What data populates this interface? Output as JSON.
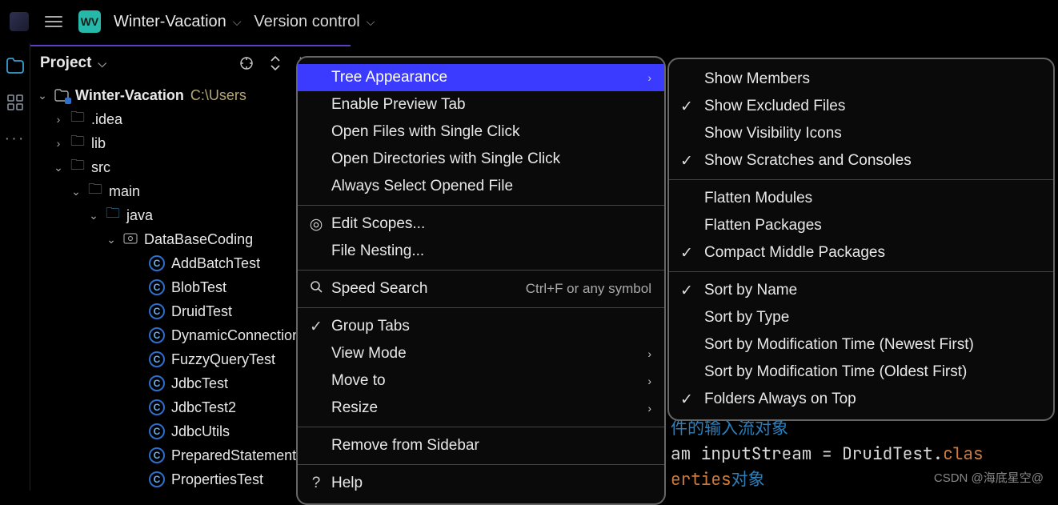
{
  "titlebar": {
    "wv_badge": "WV",
    "project_name": "Winter-Vacation",
    "version_control": "Version control"
  },
  "panel": {
    "title": "Project"
  },
  "tree": {
    "root_name": "Winter-Vacation",
    "root_path": "C:\\Users",
    "idea": ".idea",
    "lib": "lib",
    "src": "src",
    "main": "main",
    "java": "java",
    "pkg": "DataBaseCoding",
    "c0": "AddBatchTest",
    "c1": "BlobTest",
    "c2": "DruidTest",
    "c3": "DynamicConnection",
    "c4": "FuzzyQueryTest",
    "c5": "JdbcTest",
    "c6": "JdbcTest2",
    "c7": "JdbcUtils",
    "c8": "PreparedStatement",
    "c9": "PropertiesTest"
  },
  "menu": {
    "tree_appearance": "Tree Appearance",
    "enable_preview": "Enable Preview Tab",
    "open_files_single": "Open Files with Single Click",
    "open_dirs_single": "Open Directories with Single Click",
    "always_select": "Always Select Opened File",
    "edit_scopes": "Edit Scopes...",
    "file_nesting": "File Nesting...",
    "speed_search": "Speed Search",
    "speed_search_hint": "Ctrl+F or any symbol",
    "group_tabs": "Group Tabs",
    "view_mode": "View Mode",
    "move_to": "Move to",
    "resize": "Resize",
    "remove_sidebar": "Remove from Sidebar",
    "help": "Help"
  },
  "submenu": {
    "show_members": "Show Members",
    "show_excluded": "Show Excluded Files",
    "show_visibility": "Show Visibility Icons",
    "show_scratches": "Show Scratches and Consoles",
    "flatten_modules": "Flatten Modules",
    "flatten_packages": "Flatten Packages",
    "compact_middle": "Compact Middle Packages",
    "sort_name": "Sort by Name",
    "sort_type": "Sort by Type",
    "sort_newest": "Sort by Modification Time (Newest First)",
    "sort_oldest": "Sort by Modification Time (Oldest First)",
    "folders_top": "Folders Always on Top"
  },
  "editor": {
    "line1_cn": "件的输入流对象",
    "line2_a": "am inputStream = DruidTest.",
    "line2_b": "clas",
    "line3_a": "erties",
    "line3_b": "对象"
  },
  "watermark": "CSDN @海底星空@"
}
